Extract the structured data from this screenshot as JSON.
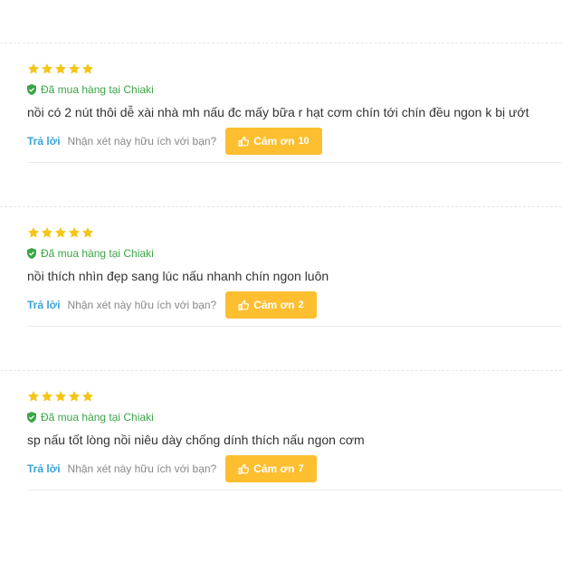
{
  "colors": {
    "star": "#f5c518",
    "verified": "#3aa545",
    "reply": "#3aa3d8",
    "thanks_bg": "#fdbf30"
  },
  "icons": {
    "star": "star-icon",
    "verified": "shield-check-icon",
    "thanks": "thumbs-up-icon"
  },
  "reviews": [
    {
      "rating": 5,
      "verified_label": "Đã mua hàng tại Chiaki",
      "content": "nồi có 2 nút thôi dễ xài nhà mh nấu đc mấy bữa r hạt cơm chín tới chín đều ngon k bị ướt",
      "reply_label": "Trả lời",
      "question": "Nhận xét này hữu ích với bạn?",
      "thanks_label": "Cảm ơn",
      "thanks_count": "10"
    },
    {
      "rating": 5,
      "verified_label": "Đã mua hàng tại Chiaki",
      "content": "nồi thích nhìn đẹp sang lúc nấu nhanh chín ngon luôn",
      "reply_label": "Trả lời",
      "question": "Nhận xét này hữu ích với bạn?",
      "thanks_label": "Cảm ơn",
      "thanks_count": "2"
    },
    {
      "rating": 5,
      "verified_label": "Đã mua hàng tại Chiaki",
      "content": "sp nấu tốt lòng nồi niêu dày chống dính thích nấu ngon cơm",
      "reply_label": "Trả lời",
      "question": "Nhận xét này hữu ích với bạn?",
      "thanks_label": "Cảm ơn",
      "thanks_count": "7"
    }
  ]
}
